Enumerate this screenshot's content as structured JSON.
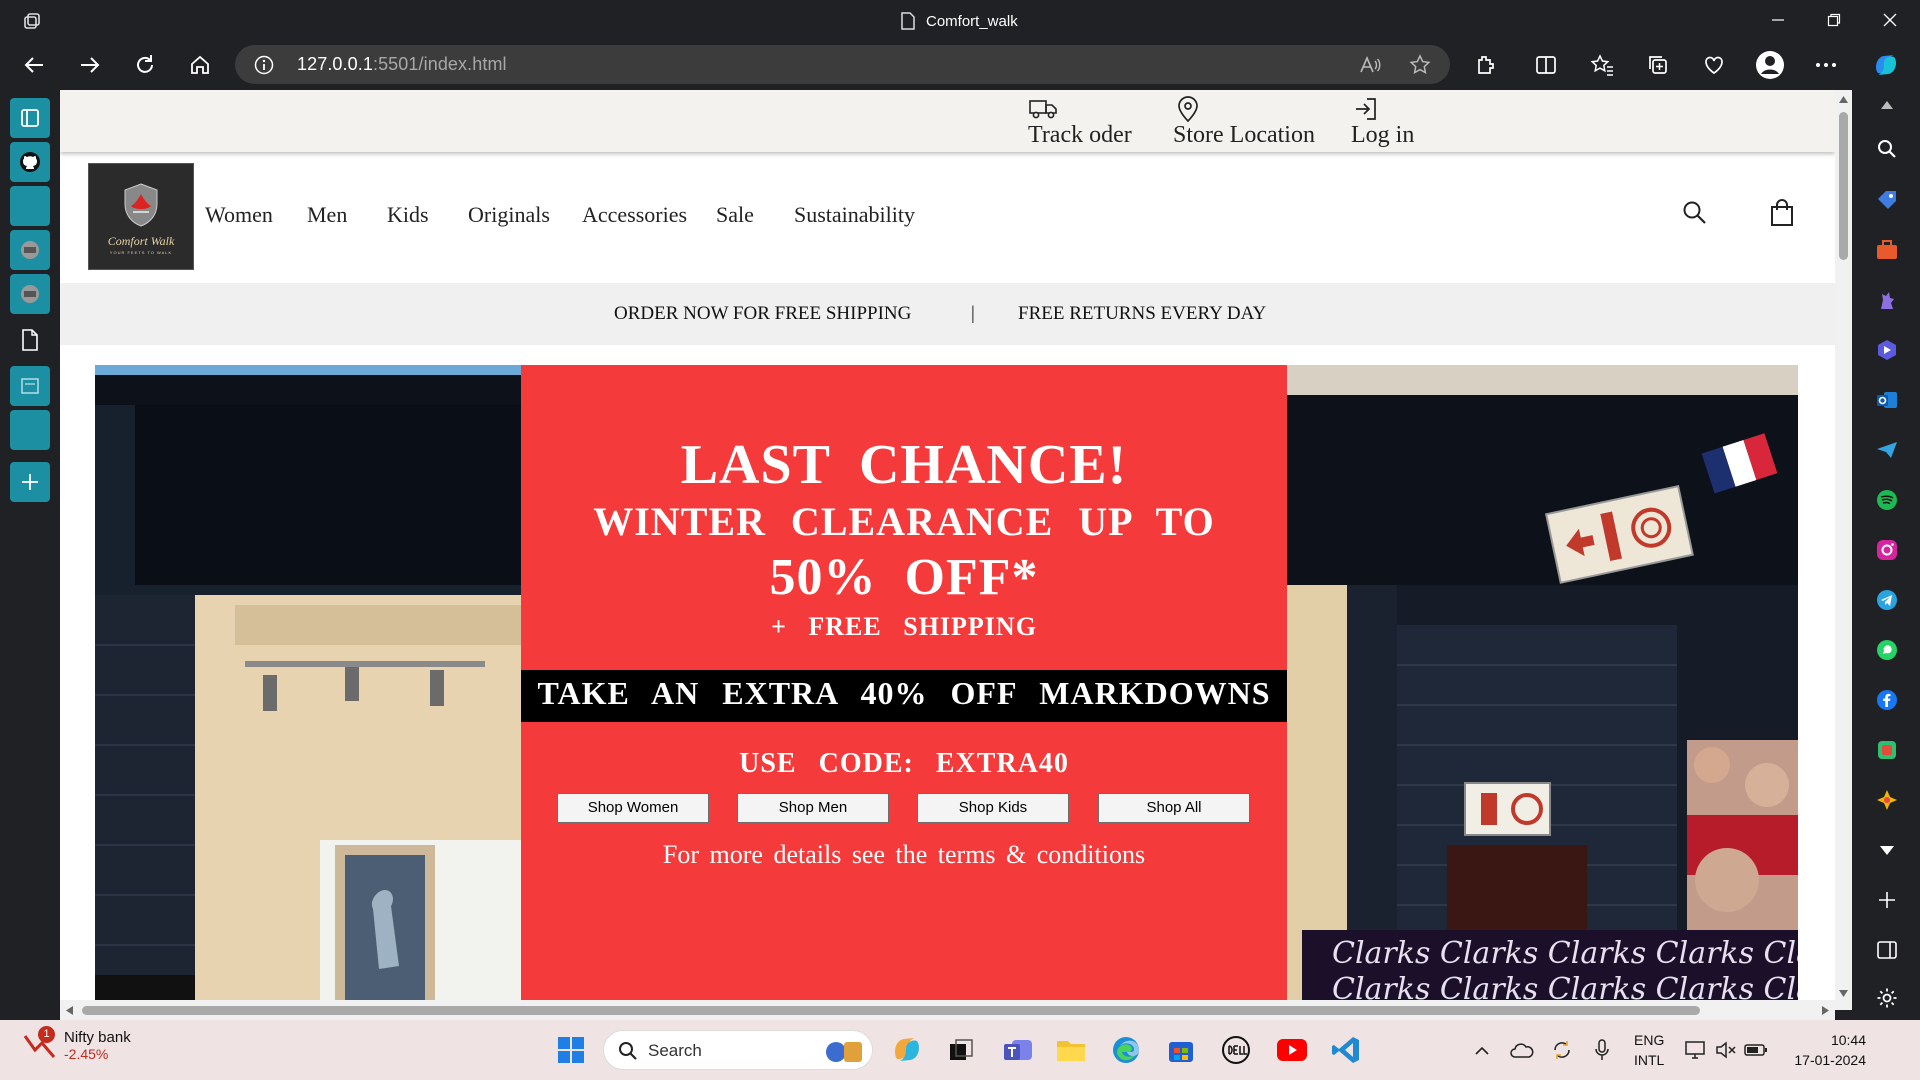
{
  "browser": {
    "tab_title": "Comfort_walk",
    "url_host": "127.0.0.1",
    "url_rest": ":5501/index.html"
  },
  "site": {
    "top_links": [
      {
        "label": "Track oder",
        "icon": "truck-icon"
      },
      {
        "label": "Store Location",
        "icon": "location-pin-icon"
      },
      {
        "label": "Log in",
        "icon": "login-icon"
      }
    ],
    "logo": {
      "text": "Comfort Walk",
      "tagline": "YOUR FEETS TO WALK"
    },
    "nav": [
      "Women",
      "Men",
      "Kids",
      "Originals",
      "Accessories",
      "Sale",
      "Sustainability"
    ],
    "promo": {
      "left": "ORDER NOW FOR FREE SHIPPING",
      "separator": "|",
      "right": "FREE RETURNS EVERY DAY"
    },
    "banner": {
      "line1": "LAST CHANCE!",
      "line2": "WINTER CLEARANCE UP TO",
      "line3": "50% OFF*",
      "line4": "+ FREE SHIPPING",
      "bar": "TAKE AN EXTRA 40% OFF MARKDOWNS",
      "code": "USE CODE: EXTRA40",
      "buttons": [
        "Shop Women",
        "Shop Men",
        "Shop Kids",
        "Shop All"
      ],
      "terms": "For more details see the terms & conditions"
    },
    "store_sign": "Clarks"
  },
  "taskbar": {
    "stock_name": "Nifty bank",
    "stock_change": "-2.45%",
    "stock_badge": "1",
    "search": "Search",
    "lang_line1": "ENG",
    "lang_line2": "INTL",
    "time": "10:44",
    "date": "17-01-2024"
  },
  "colors": {
    "banner_red": "#f43a3a",
    "sidebar_teal": "#1c8fa3",
    "dark": "#202124"
  }
}
